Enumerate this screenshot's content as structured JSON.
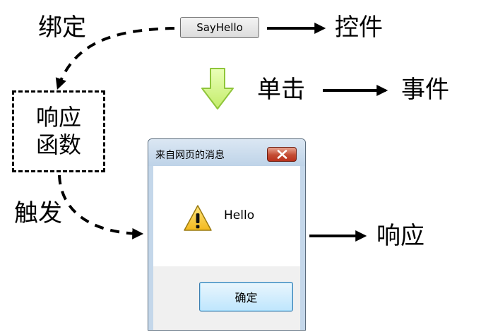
{
  "labels": {
    "bind": "绑定",
    "control": "控件",
    "click": "单击",
    "event": "事件",
    "trigger": "触发",
    "response": "响应",
    "function_line1": "响应",
    "function_line2": "函数"
  },
  "control_button": {
    "label": "SayHello"
  },
  "dialog": {
    "title": "来自网页的消息",
    "message": "Hello",
    "ok_label": "确定",
    "close_icon": "close-x-icon",
    "message_icon": "warning-icon"
  },
  "colors": {
    "flow_arrow_fill": "#d6f58f",
    "flow_arrow_stroke": "#8fc53a",
    "close_button": "#c44a32",
    "ok_button_border": "#3c7fb1"
  }
}
